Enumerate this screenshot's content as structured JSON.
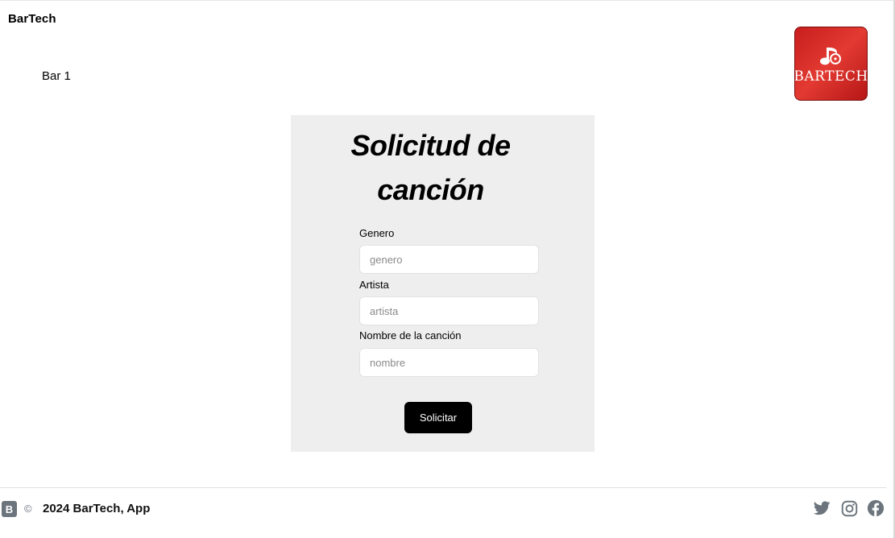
{
  "header": {
    "brand": "BarTech",
    "bar_name": "Bar 1",
    "logo_text": "BARTECH"
  },
  "form": {
    "title_line1": "Solicitud de",
    "title_line2": "canción",
    "fields": [
      {
        "label": "Genero",
        "placeholder": "genero",
        "value": ""
      },
      {
        "label": "Artista",
        "placeholder": "artista",
        "value": ""
      },
      {
        "label": "Nombre de la canción",
        "placeholder": "nombre",
        "value": ""
      }
    ],
    "submit_label": "Solicitar"
  },
  "footer": {
    "bootstrap_badge": "B",
    "copyright_symbol": "©",
    "copyright_text": "2024 BarTech, App",
    "social_icons": [
      "twitter-icon",
      "instagram-icon",
      "facebook-icon"
    ]
  },
  "colors": {
    "logo_red": "#d42a25",
    "card_bg": "#eeeeee",
    "button_bg": "#000000",
    "icon_gray": "#6c757d"
  }
}
